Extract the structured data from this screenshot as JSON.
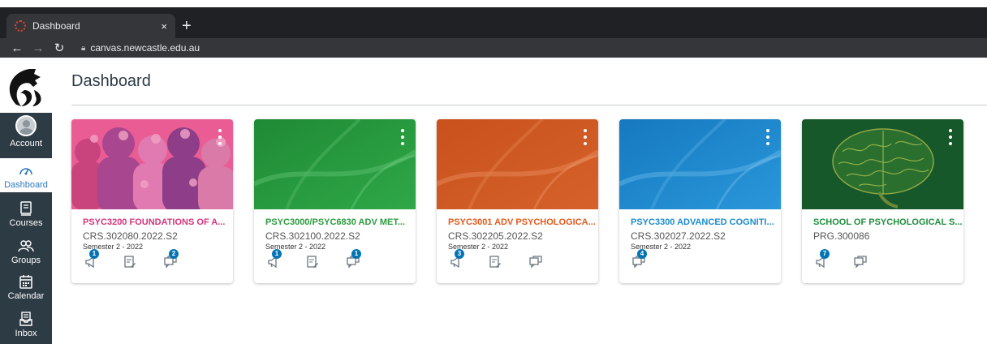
{
  "browser": {
    "tab_title": "Dashboard",
    "tab_close": "×",
    "new_tab": "+",
    "url": "canvas.newcastle.edu.au"
  },
  "nav": {
    "account": "Account",
    "dashboard": "Dashboard",
    "courses": "Courses",
    "groups": "Groups",
    "calendar": "Calendar",
    "inbox": "Inbox"
  },
  "page": {
    "title": "Dashboard"
  },
  "cards": [
    {
      "name": "PSYC3200 FOUNDATIONS OF A...",
      "code": "CRS.302080.2022.S2",
      "term": "Semester 2 - 2022",
      "color": "#d6347c",
      "announcements_badge": "1",
      "discussions_badge": "2"
    },
    {
      "name": "PSYC3000/PSYC6830 ADV MET...",
      "code": "CRS.302100.2022.S2",
      "term": "Semester 2 - 2022",
      "color": "#2c9b3f",
      "announcements_badge": "1",
      "discussions_badge": "1"
    },
    {
      "name": "PSYC3001 ADV PSYCHOLOGICA...",
      "code": "CRS.302205.2022.S2",
      "term": "Semester 2 - 2022",
      "color": "#e25a1c",
      "announcements_badge": "3",
      "discussions_badge": ""
    },
    {
      "name": "PSYC3300 ADVANCED COGNITI...",
      "code": "CRS.302027.2022.S2",
      "term": "Semester 2 - 2022",
      "color": "#1b8dd0",
      "announcements_badge": "",
      "discussions_badge": "4"
    },
    {
      "name": "SCHOOL OF PSYCHOLOGICAL S...",
      "code": "PRG.300086",
      "term": "",
      "color": "#1e8f3c",
      "announcements_badge": "7",
      "discussions_badge": ""
    }
  ]
}
